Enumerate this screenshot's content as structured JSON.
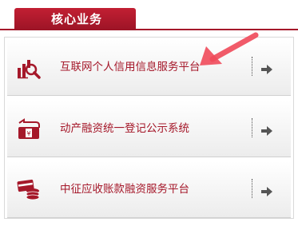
{
  "header": {
    "tab_label": "核心业务"
  },
  "services": [
    {
      "label": "互联网个人信用信息服务平台",
      "icon": "credit-search-icon"
    },
    {
      "label": "动产融资统一登记公示系统",
      "icon": "registration-icon"
    },
    {
      "label": "中征应收账款融资服务平台",
      "icon": "card-coins-icon"
    }
  ],
  "colors": {
    "brand_red": "#a5182a",
    "tab_red": "#c21f33",
    "annotation_pink": "#f04a5a",
    "arrow_gray": "#555555"
  },
  "annotation": {
    "type": "arrow",
    "points_to": "互联网个人信用信息服务平台"
  }
}
